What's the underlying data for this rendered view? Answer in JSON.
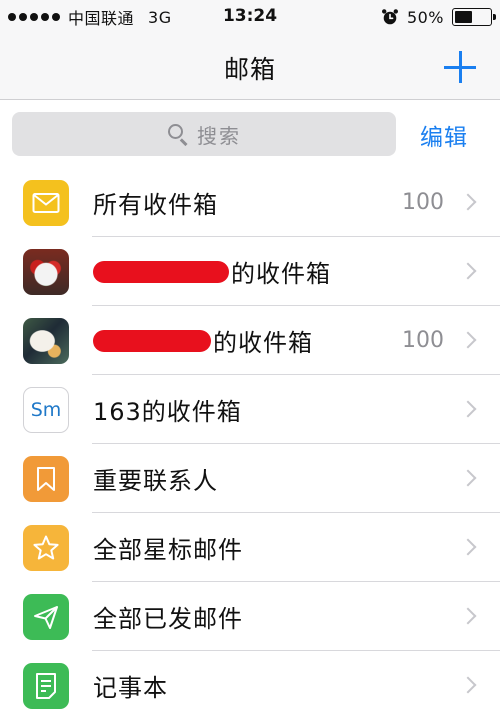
{
  "status_bar": {
    "carrier": "中国联通",
    "network": "3G",
    "time": "13:24",
    "battery": "50%",
    "battery_level": 0.5
  },
  "nav": {
    "title": "邮箱",
    "add_icon": "plus-icon"
  },
  "search": {
    "placeholder": "搜索",
    "edit_label": "编辑"
  },
  "mailboxes": [
    {
      "label": "所有收件箱",
      "count": "100",
      "icon": "envelope-icon"
    },
    {
      "label": "的收件箱",
      "count": "",
      "icon": "avatar-photo",
      "redacted": true
    },
    {
      "label": "的收件箱",
      "count": "100",
      "icon": "avatar-photo",
      "redacted": true
    },
    {
      "label": "163的收件箱",
      "count": "",
      "icon": "sm-text-icon",
      "icon_text": "Sm"
    },
    {
      "label": "重要联系人",
      "count": "",
      "icon": "bookmark-icon"
    },
    {
      "label": "全部星标邮件",
      "count": "",
      "icon": "star-icon"
    },
    {
      "label": "全部已发邮件",
      "count": "",
      "icon": "paper-plane-icon"
    },
    {
      "label": "记事本",
      "count": "",
      "icon": "note-icon"
    }
  ],
  "colors": {
    "accent": "#1a7ff0",
    "inbox_yellow": "#f4c11e",
    "vip_orange": "#f19a38",
    "star_yellow": "#f6b53a",
    "sent_green": "#3dbb56",
    "notes_green": "#3dbb56",
    "redaction_red": "#e8101d"
  }
}
